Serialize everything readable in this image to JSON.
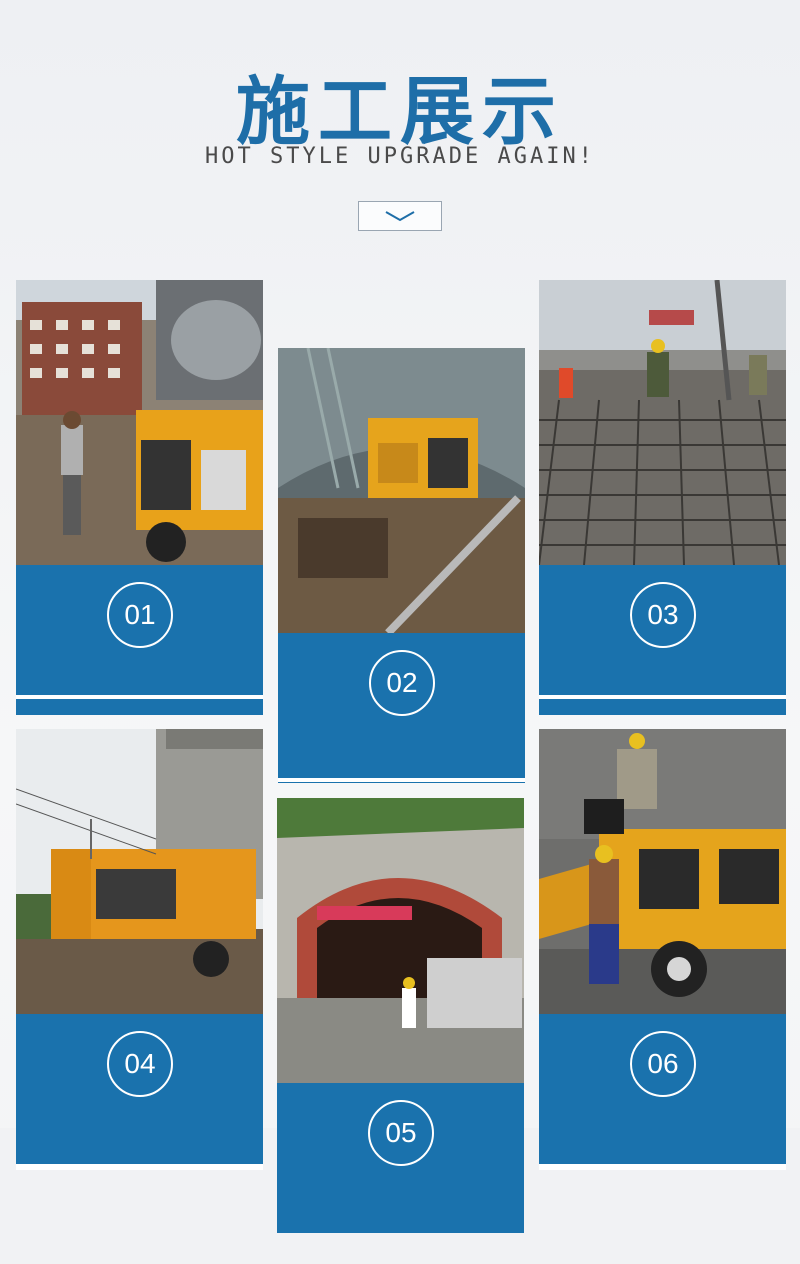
{
  "header": {
    "title": "施工展示",
    "subtitle": "HOT STYLE UPGRADE AGAIN!"
  },
  "accent_color": "#1a72ad",
  "title_color": "#1e6ea8",
  "chevron_icon": "chevron-down-icon",
  "gallery": [
    {
      "number": "01"
    },
    {
      "number": "02"
    },
    {
      "number": "03"
    },
    {
      "number": "04"
    },
    {
      "number": "05"
    },
    {
      "number": "06"
    }
  ]
}
